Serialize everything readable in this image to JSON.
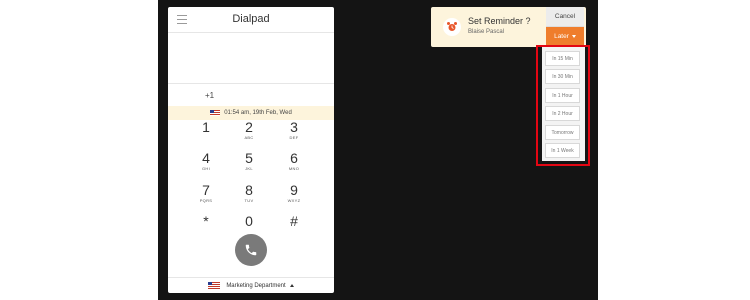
{
  "dialpad": {
    "title": "Dialpad",
    "country_code": "+1",
    "timestamp": "01:54 am, 19th Feb, Wed",
    "keys": [
      {
        "digit": "1",
        "letters": ""
      },
      {
        "digit": "2",
        "letters": "ABC"
      },
      {
        "digit": "3",
        "letters": "DEF"
      },
      {
        "digit": "4",
        "letters": "GHI"
      },
      {
        "digit": "5",
        "letters": "JKL"
      },
      {
        "digit": "6",
        "letters": "MNO"
      },
      {
        "digit": "7",
        "letters": "PQRS"
      },
      {
        "digit": "8",
        "letters": "TUV"
      },
      {
        "digit": "9",
        "letters": "WXYZ"
      },
      {
        "digit": "*",
        "letters": ""
      },
      {
        "digit": "0",
        "letters": ""
      },
      {
        "digit": "#",
        "letters": ""
      }
    ],
    "department": "Marketing Department"
  },
  "reminder": {
    "title": "Set Reminder ?",
    "contact": "Blaise Pascal",
    "cancel_label": "Cancel",
    "later_label": "Later",
    "options": [
      "In 15 Min",
      "In 30 Min",
      "In 1 Hour",
      "In 2 Hour",
      "Tomorrow",
      "In 1 Week"
    ]
  },
  "icons": {
    "menu": "hamburger-menu-icon",
    "call": "phone-icon",
    "alarm": "alarm-clock-icon",
    "flag": "us-flag-icon"
  },
  "colors": {
    "accent": "#ef7d2c",
    "reminder_bg": "#fdf4dc",
    "highlight": "#e30613",
    "backdrop": "#141414"
  }
}
